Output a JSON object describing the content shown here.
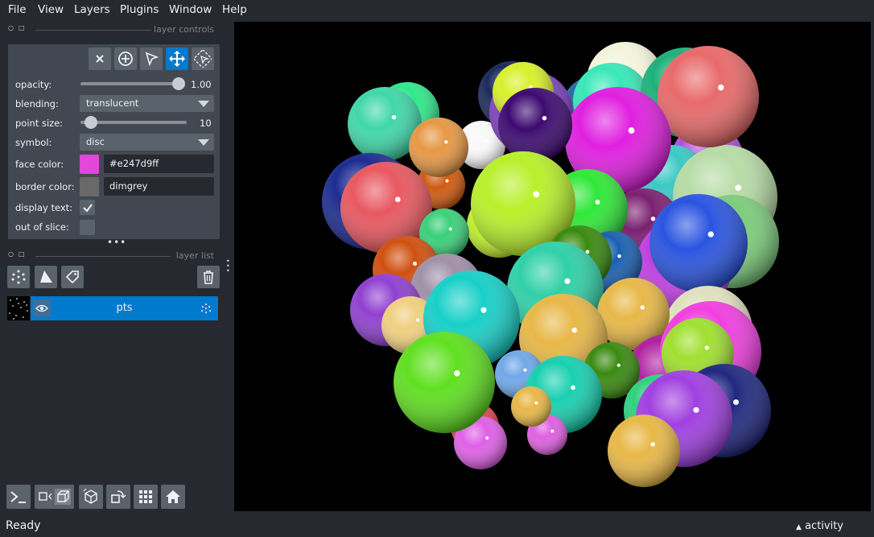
{
  "menu": [
    "File",
    "View",
    "Layers",
    "Plugins",
    "Window",
    "Help"
  ],
  "layer_controls": {
    "title": "layer controls",
    "opacity": {
      "label": "opacity:",
      "value": "1.00",
      "level": 1.0
    },
    "blending": {
      "label": "blending:",
      "value": "translucent"
    },
    "point_size": {
      "label": "point size:",
      "value": "10",
      "level": 0.1
    },
    "symbol": {
      "label": "symbol:",
      "value": "disc"
    },
    "face_color": {
      "label": "face color:",
      "value": "#e247d9ff",
      "swatch": "#e247d9"
    },
    "border_color": {
      "label": "border color:",
      "value": "dimgrey",
      "swatch": "#696969"
    },
    "display_text": {
      "label": "display text:",
      "checked": true
    },
    "out_of_slice": {
      "label": "out of slice:",
      "checked": false
    }
  },
  "layer_list": {
    "title": "layer list",
    "layers": [
      {
        "name": "pts",
        "visible": true,
        "selected": true
      }
    ]
  },
  "status": {
    "text": "Ready",
    "activity": "activity"
  },
  "colors": {
    "accent": "#007acc",
    "background": "#262930",
    "panel": "#414851",
    "button": "#5a626c"
  }
}
